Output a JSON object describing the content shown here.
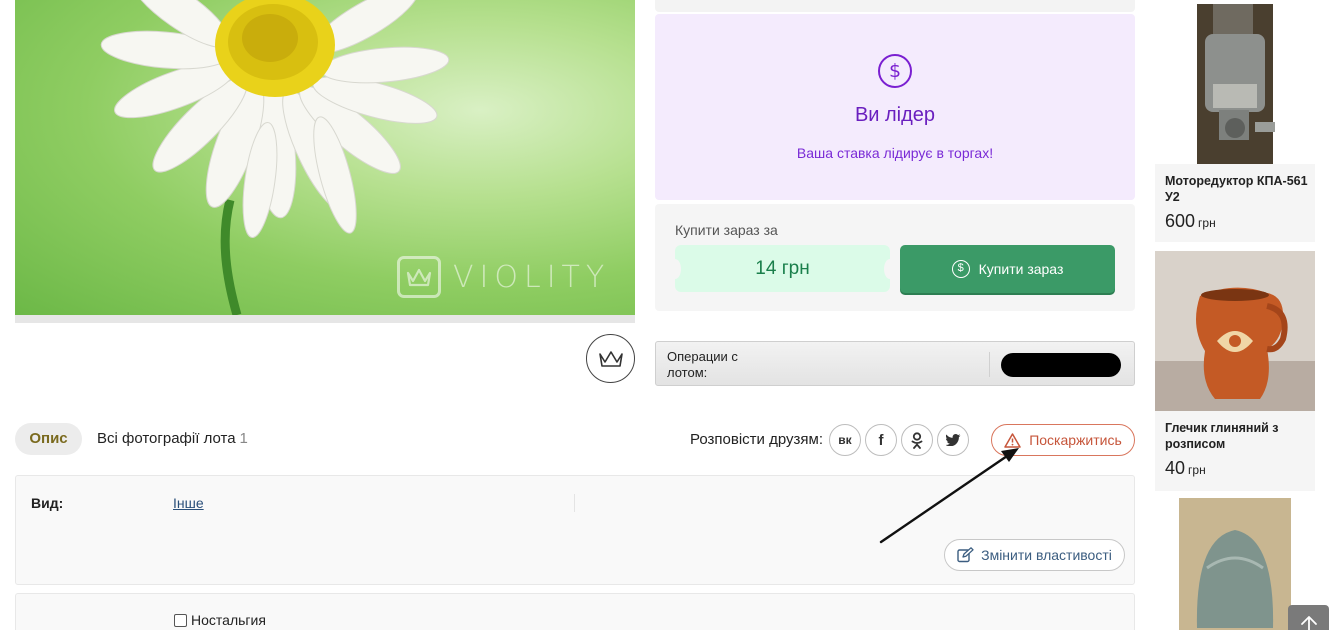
{
  "photo": {
    "watermark": "VIOLITY"
  },
  "leader": {
    "icon": "$",
    "title": "Ви лідер",
    "subtitle": "Ваша ставка лідирує в торгах!"
  },
  "buy_now": {
    "label": "Купити зараз за",
    "price": "14 грн",
    "button": "Купити зараз",
    "icon": "$"
  },
  "operations": {
    "label": "Операции с лотом:"
  },
  "tabs": {
    "description": "Опис",
    "photos": "Всі фотографії лота",
    "photos_count": "1"
  },
  "share": {
    "label": "Розповісти друзям:",
    "networks": [
      "vk-icon",
      "facebook-icon",
      "odnoklassniki-icon",
      "twitter-icon"
    ]
  },
  "complain": {
    "label": "Поскаржитись"
  },
  "properties": {
    "type_label": "Вид:",
    "type_value": "Інше",
    "edit_button": "Змінити властивості"
  },
  "properties2": {
    "checkbox_label": "Ностальгия"
  },
  "sidebar": {
    "items": [
      {
        "title": "Моторедуктор КПА-561 У2",
        "price": "600",
        "currency": "грн"
      },
      {
        "title": "Глечик глиняний з розписом",
        "price": "40",
        "currency": "грн"
      },
      {
        "title": "",
        "price": "",
        "currency": ""
      }
    ]
  },
  "colors": {
    "leader_bg": "#f4ebfd",
    "leader_accent": "#7a1fd1",
    "buy_green": "#3b9a67",
    "ticket_bg": "#dbfbe8",
    "complain_red": "#c6553a"
  }
}
